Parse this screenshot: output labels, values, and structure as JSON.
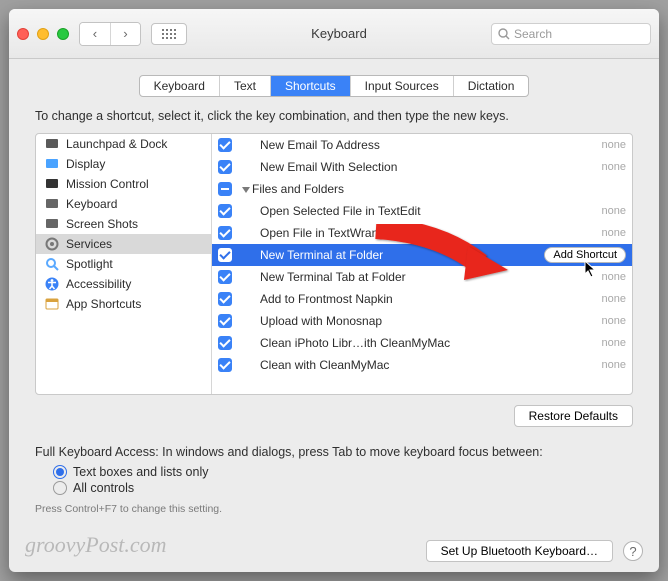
{
  "window": {
    "title": "Keyboard"
  },
  "search": {
    "placeholder": "Search"
  },
  "tabs": [
    "Keyboard",
    "Text",
    "Shortcuts",
    "Input Sources",
    "Dictation"
  ],
  "active_tab": 2,
  "instruction": "To change a shortcut, select it, click the key combination, and then type the new keys.",
  "sidebar": {
    "items": [
      {
        "label": "Launchpad & Dock",
        "icon": "launchpad"
      },
      {
        "label": "Display",
        "icon": "display"
      },
      {
        "label": "Mission Control",
        "icon": "mission"
      },
      {
        "label": "Keyboard",
        "icon": "keyboard"
      },
      {
        "label": "Screen Shots",
        "icon": "screenshot"
      },
      {
        "label": "Services",
        "icon": "gear"
      },
      {
        "label": "Spotlight",
        "icon": "spotlight"
      },
      {
        "label": "Accessibility",
        "icon": "accessibility"
      },
      {
        "label": "App Shortcuts",
        "icon": "apps"
      }
    ],
    "selected": 5
  },
  "services": {
    "rows": [
      {
        "type": "item",
        "checked": true,
        "label": "New Email To Address",
        "shortcut": "none"
      },
      {
        "type": "item",
        "checked": true,
        "label": "New Email With Selection",
        "shortcut": "none"
      },
      {
        "type": "group",
        "checked": "minus",
        "label": "Files and Folders"
      },
      {
        "type": "item",
        "checked": true,
        "label": "Open Selected File in TextEdit",
        "shortcut": "none"
      },
      {
        "type": "item",
        "checked": true,
        "label": "Open File in TextWrangler",
        "shortcut": "none"
      },
      {
        "type": "item",
        "checked": true,
        "label": "New Terminal at Folder",
        "shortcut": "",
        "selected": true,
        "add_shortcut": true
      },
      {
        "type": "item",
        "checked": true,
        "label": "New Terminal Tab at Folder",
        "shortcut": "none"
      },
      {
        "type": "item",
        "checked": true,
        "label": "Add to Frontmost Napkin",
        "shortcut": "none"
      },
      {
        "type": "item",
        "checked": true,
        "label": "Upload with Monosnap",
        "shortcut": "none"
      },
      {
        "type": "item",
        "checked": true,
        "label": "Clean iPhoto Libr…ith CleanMyMac",
        "shortcut": "none"
      },
      {
        "type": "item",
        "checked": true,
        "label": "Clean with CleanMyMac",
        "shortcut": "none"
      }
    ]
  },
  "buttons": {
    "restore": "Restore Defaults",
    "add_shortcut": "Add Shortcut",
    "bluetooth": "Set Up Bluetooth Keyboard…"
  },
  "access": {
    "heading": "Full Keyboard Access: In windows and dialogs, press Tab to move keyboard focus between:",
    "options": [
      "Text boxes and lists only",
      "All controls"
    ],
    "selected": 0,
    "hint": "Press Control+F7 to change this setting."
  },
  "watermark": "groovyPost.com"
}
